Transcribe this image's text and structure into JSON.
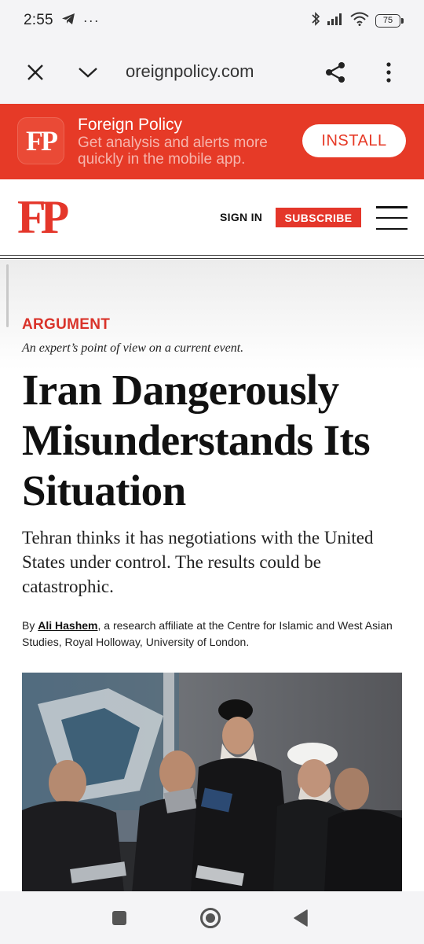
{
  "status_bar": {
    "time": "2:55",
    "more_dots": "···",
    "battery_level": "75"
  },
  "browser": {
    "url": "oreignpolicy.com"
  },
  "app_banner": {
    "logo_text": "FP",
    "title": "Foreign Policy",
    "subtitle": "Get analysis and alerts more quickly in the mobile app.",
    "install_label": "INSTALL"
  },
  "site_header": {
    "logo_text": "FP",
    "sign_in_label": "SIGN IN",
    "subscribe_label": "SUBSCRIBE"
  },
  "article": {
    "kicker": "ARGUMENT",
    "kicker_description": "An expert’s point of view on a current event.",
    "headline": "Iran Dangerously Misunderstands Its Situation",
    "dek": "Tehran thinks it has negotiations with the United States under control. The results could be catastrophic.",
    "byline_prefix": "By ",
    "author_name": "Ali Hashem",
    "author_bio": ", a research affiliate at the Centre for Islamic and West Asian Studies, Royal Holloway, University of London."
  },
  "colors": {
    "brand_red": "#e4362a",
    "banner_red": "#e63a27",
    "chrome_bg": "#f4f4f6"
  },
  "icons": {
    "status_left": [
      "telegram-icon"
    ],
    "status_right": [
      "bluetooth-icon",
      "signal-icon",
      "wifi-icon",
      "battery-icon"
    ],
    "toolbar": [
      "close-icon",
      "chevron-down-icon",
      "share-icon",
      "more-vert-icon"
    ],
    "nav": [
      "recents-square-icon",
      "home-circle-icon",
      "back-triangle-icon"
    ]
  }
}
